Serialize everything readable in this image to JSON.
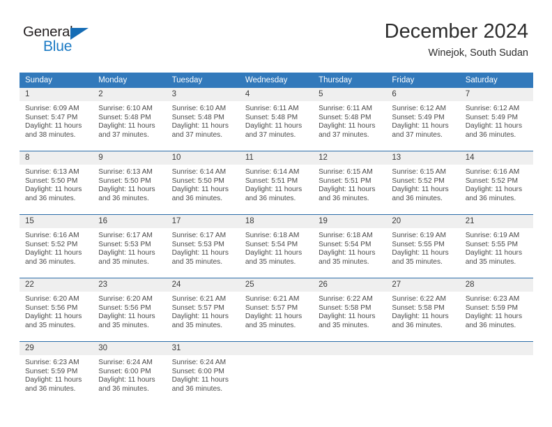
{
  "brand": {
    "name_part1": "General",
    "name_part2": "Blue",
    "triangle_icon": "blue-triangle-logo-mark",
    "color_dark": "#231f20",
    "color_blue": "#1b7ac4"
  },
  "header": {
    "title": "December 2024",
    "subtitle": "Winejok, South Sudan"
  },
  "calendar": {
    "header_color": "#3279bb",
    "daynum_band_color": "#efefef",
    "weekday_headers": [
      "Sunday",
      "Monday",
      "Tuesday",
      "Wednesday",
      "Thursday",
      "Friday",
      "Saturday"
    ],
    "weeks": [
      [
        {
          "day": "1",
          "sunrise": "Sunrise: 6:09 AM",
          "sunset": "Sunset: 5:47 PM",
          "daylight_line1": "Daylight: 11 hours",
          "daylight_line2": "and 38 minutes."
        },
        {
          "day": "2",
          "sunrise": "Sunrise: 6:10 AM",
          "sunset": "Sunset: 5:48 PM",
          "daylight_line1": "Daylight: 11 hours",
          "daylight_line2": "and 37 minutes."
        },
        {
          "day": "3",
          "sunrise": "Sunrise: 6:10 AM",
          "sunset": "Sunset: 5:48 PM",
          "daylight_line1": "Daylight: 11 hours",
          "daylight_line2": "and 37 minutes."
        },
        {
          "day": "4",
          "sunrise": "Sunrise: 6:11 AM",
          "sunset": "Sunset: 5:48 PM",
          "daylight_line1": "Daylight: 11 hours",
          "daylight_line2": "and 37 minutes."
        },
        {
          "day": "5",
          "sunrise": "Sunrise: 6:11 AM",
          "sunset": "Sunset: 5:48 PM",
          "daylight_line1": "Daylight: 11 hours",
          "daylight_line2": "and 37 minutes."
        },
        {
          "day": "6",
          "sunrise": "Sunrise: 6:12 AM",
          "sunset": "Sunset: 5:49 PM",
          "daylight_line1": "Daylight: 11 hours",
          "daylight_line2": "and 37 minutes."
        },
        {
          "day": "7",
          "sunrise": "Sunrise: 6:12 AM",
          "sunset": "Sunset: 5:49 PM",
          "daylight_line1": "Daylight: 11 hours",
          "daylight_line2": "and 36 minutes."
        }
      ],
      [
        {
          "day": "8",
          "sunrise": "Sunrise: 6:13 AM",
          "sunset": "Sunset: 5:50 PM",
          "daylight_line1": "Daylight: 11 hours",
          "daylight_line2": "and 36 minutes."
        },
        {
          "day": "9",
          "sunrise": "Sunrise: 6:13 AM",
          "sunset": "Sunset: 5:50 PM",
          "daylight_line1": "Daylight: 11 hours",
          "daylight_line2": "and 36 minutes."
        },
        {
          "day": "10",
          "sunrise": "Sunrise: 6:14 AM",
          "sunset": "Sunset: 5:50 PM",
          "daylight_line1": "Daylight: 11 hours",
          "daylight_line2": "and 36 minutes."
        },
        {
          "day": "11",
          "sunrise": "Sunrise: 6:14 AM",
          "sunset": "Sunset: 5:51 PM",
          "daylight_line1": "Daylight: 11 hours",
          "daylight_line2": "and 36 minutes."
        },
        {
          "day": "12",
          "sunrise": "Sunrise: 6:15 AM",
          "sunset": "Sunset: 5:51 PM",
          "daylight_line1": "Daylight: 11 hours",
          "daylight_line2": "and 36 minutes."
        },
        {
          "day": "13",
          "sunrise": "Sunrise: 6:15 AM",
          "sunset": "Sunset: 5:52 PM",
          "daylight_line1": "Daylight: 11 hours",
          "daylight_line2": "and 36 minutes."
        },
        {
          "day": "14",
          "sunrise": "Sunrise: 6:16 AM",
          "sunset": "Sunset: 5:52 PM",
          "daylight_line1": "Daylight: 11 hours",
          "daylight_line2": "and 36 minutes."
        }
      ],
      [
        {
          "day": "15",
          "sunrise": "Sunrise: 6:16 AM",
          "sunset": "Sunset: 5:52 PM",
          "daylight_line1": "Daylight: 11 hours",
          "daylight_line2": "and 36 minutes."
        },
        {
          "day": "16",
          "sunrise": "Sunrise: 6:17 AM",
          "sunset": "Sunset: 5:53 PM",
          "daylight_line1": "Daylight: 11 hours",
          "daylight_line2": "and 35 minutes."
        },
        {
          "day": "17",
          "sunrise": "Sunrise: 6:17 AM",
          "sunset": "Sunset: 5:53 PM",
          "daylight_line1": "Daylight: 11 hours",
          "daylight_line2": "and 35 minutes."
        },
        {
          "day": "18",
          "sunrise": "Sunrise: 6:18 AM",
          "sunset": "Sunset: 5:54 PM",
          "daylight_line1": "Daylight: 11 hours",
          "daylight_line2": "and 35 minutes."
        },
        {
          "day": "19",
          "sunrise": "Sunrise: 6:18 AM",
          "sunset": "Sunset: 5:54 PM",
          "daylight_line1": "Daylight: 11 hours",
          "daylight_line2": "and 35 minutes."
        },
        {
          "day": "20",
          "sunrise": "Sunrise: 6:19 AM",
          "sunset": "Sunset: 5:55 PM",
          "daylight_line1": "Daylight: 11 hours",
          "daylight_line2": "and 35 minutes."
        },
        {
          "day": "21",
          "sunrise": "Sunrise: 6:19 AM",
          "sunset": "Sunset: 5:55 PM",
          "daylight_line1": "Daylight: 11 hours",
          "daylight_line2": "and 35 minutes."
        }
      ],
      [
        {
          "day": "22",
          "sunrise": "Sunrise: 6:20 AM",
          "sunset": "Sunset: 5:56 PM",
          "daylight_line1": "Daylight: 11 hours",
          "daylight_line2": "and 35 minutes."
        },
        {
          "day": "23",
          "sunrise": "Sunrise: 6:20 AM",
          "sunset": "Sunset: 5:56 PM",
          "daylight_line1": "Daylight: 11 hours",
          "daylight_line2": "and 35 minutes."
        },
        {
          "day": "24",
          "sunrise": "Sunrise: 6:21 AM",
          "sunset": "Sunset: 5:57 PM",
          "daylight_line1": "Daylight: 11 hours",
          "daylight_line2": "and 35 minutes."
        },
        {
          "day": "25",
          "sunrise": "Sunrise: 6:21 AM",
          "sunset": "Sunset: 5:57 PM",
          "daylight_line1": "Daylight: 11 hours",
          "daylight_line2": "and 35 minutes."
        },
        {
          "day": "26",
          "sunrise": "Sunrise: 6:22 AM",
          "sunset": "Sunset: 5:58 PM",
          "daylight_line1": "Daylight: 11 hours",
          "daylight_line2": "and 35 minutes."
        },
        {
          "day": "27",
          "sunrise": "Sunrise: 6:22 AM",
          "sunset": "Sunset: 5:58 PM",
          "daylight_line1": "Daylight: 11 hours",
          "daylight_line2": "and 36 minutes."
        },
        {
          "day": "28",
          "sunrise": "Sunrise: 6:23 AM",
          "sunset": "Sunset: 5:59 PM",
          "daylight_line1": "Daylight: 11 hours",
          "daylight_line2": "and 36 minutes."
        }
      ],
      [
        {
          "day": "29",
          "sunrise": "Sunrise: 6:23 AM",
          "sunset": "Sunset: 5:59 PM",
          "daylight_line1": "Daylight: 11 hours",
          "daylight_line2": "and 36 minutes."
        },
        {
          "day": "30",
          "sunrise": "Sunrise: 6:24 AM",
          "sunset": "Sunset: 6:00 PM",
          "daylight_line1": "Daylight: 11 hours",
          "daylight_line2": "and 36 minutes."
        },
        {
          "day": "31",
          "sunrise": "Sunrise: 6:24 AM",
          "sunset": "Sunset: 6:00 PM",
          "daylight_line1": "Daylight: 11 hours",
          "daylight_line2": "and 36 minutes."
        },
        {
          "day": "",
          "sunrise": "",
          "sunset": "",
          "daylight_line1": "",
          "daylight_line2": ""
        },
        {
          "day": "",
          "sunrise": "",
          "sunset": "",
          "daylight_line1": "",
          "daylight_line2": ""
        },
        {
          "day": "",
          "sunrise": "",
          "sunset": "",
          "daylight_line1": "",
          "daylight_line2": ""
        },
        {
          "day": "",
          "sunrise": "",
          "sunset": "",
          "daylight_line1": "",
          "daylight_line2": ""
        }
      ]
    ]
  }
}
